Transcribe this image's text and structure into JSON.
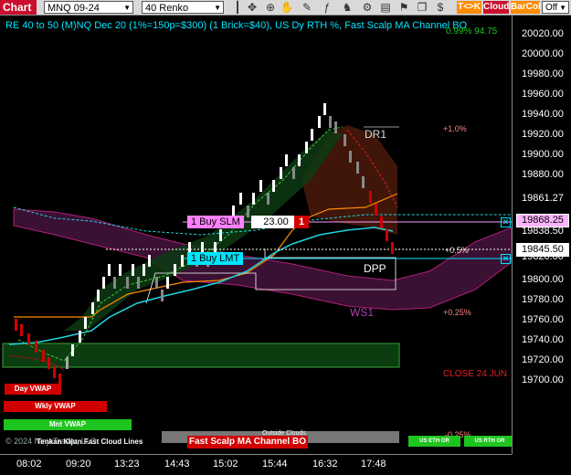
{
  "toolbar": {
    "tab": "Chart",
    "instrument": "MNQ 09-24",
    "bar_type": "40 Renko",
    "buttons": [
      {
        "label": "T<>K",
        "color": "#ff8c00"
      },
      {
        "label": "Cloud",
        "color": "#c8102e"
      },
      {
        "label": "BarCol",
        "color": "#ff8c00"
      }
    ],
    "off_label": "Off",
    "icons": [
      "bar-style-icon",
      "crosshair-icon",
      "zoom-icon",
      "pan-icon",
      "drawing-icon",
      "indicators-icon",
      "strategy-icon",
      "properties-icon",
      "data-box-icon",
      "alerts-icon",
      "templates-icon",
      "chart-trader-icon"
    ]
  },
  "header_text": "RE 40 to 50 (M)NQ Dec 20 (1%=150p=$300) (1 Brick=$40), US Dy RTH %, Fast Scalp MA Channel BO",
  "header_right": "0.99% 94.75",
  "price_ticks": [
    "20020.00",
    "20000.00",
    "19980.00",
    "19960.00",
    "19940.00",
    "19920.00",
    "19900.00",
    "19880.00",
    "19861.27",
    "19838.50",
    "19820.00",
    "19800.00",
    "19780.00",
    "19760.00",
    "19740.00",
    "19720.00",
    "19700.00"
  ],
  "price_labels": {
    "order_stop": "19868.25",
    "last": "19845.50"
  },
  "time_ticks": [
    "08:02",
    "09:20",
    "13:23",
    "14:43",
    "15:02",
    "15:44",
    "16:32",
    "17:48"
  ],
  "levels": {
    "dr1": "DR1",
    "dpp": "DPP",
    "ws1": "WS1",
    "pct_1": "+1.0%",
    "pct_05": "+0.5%",
    "pct_025": "+0.25%",
    "pct_m025": "-0.25%",
    "close": "CLOSE 24 JUN"
  },
  "orders": {
    "stop_label": "1 Buy SLM",
    "stop_price": "23.00",
    "stop_qty": "1",
    "limit_label": "1 Buy LMT"
  },
  "left_tags": [
    {
      "label": "Day VWAP",
      "color": "#d10000"
    },
    {
      "label": "Wkly VWAP",
      "color": "#d10000"
    },
    {
      "label": "Mnt VWAP",
      "color": "#1ec51e"
    }
  ],
  "bottom_tags": {
    "outside_clouds": "Outside Clouds",
    "strategy": "Fast Scalp MA Channel BO",
    "us_eth": "US ETH OR",
    "us_rth": "US RTH OR"
  },
  "copyright": "© 2024 NinjaTrader, LLC",
  "overlay_label": "Tenkan Kijun Fast Cloud Lines"
}
